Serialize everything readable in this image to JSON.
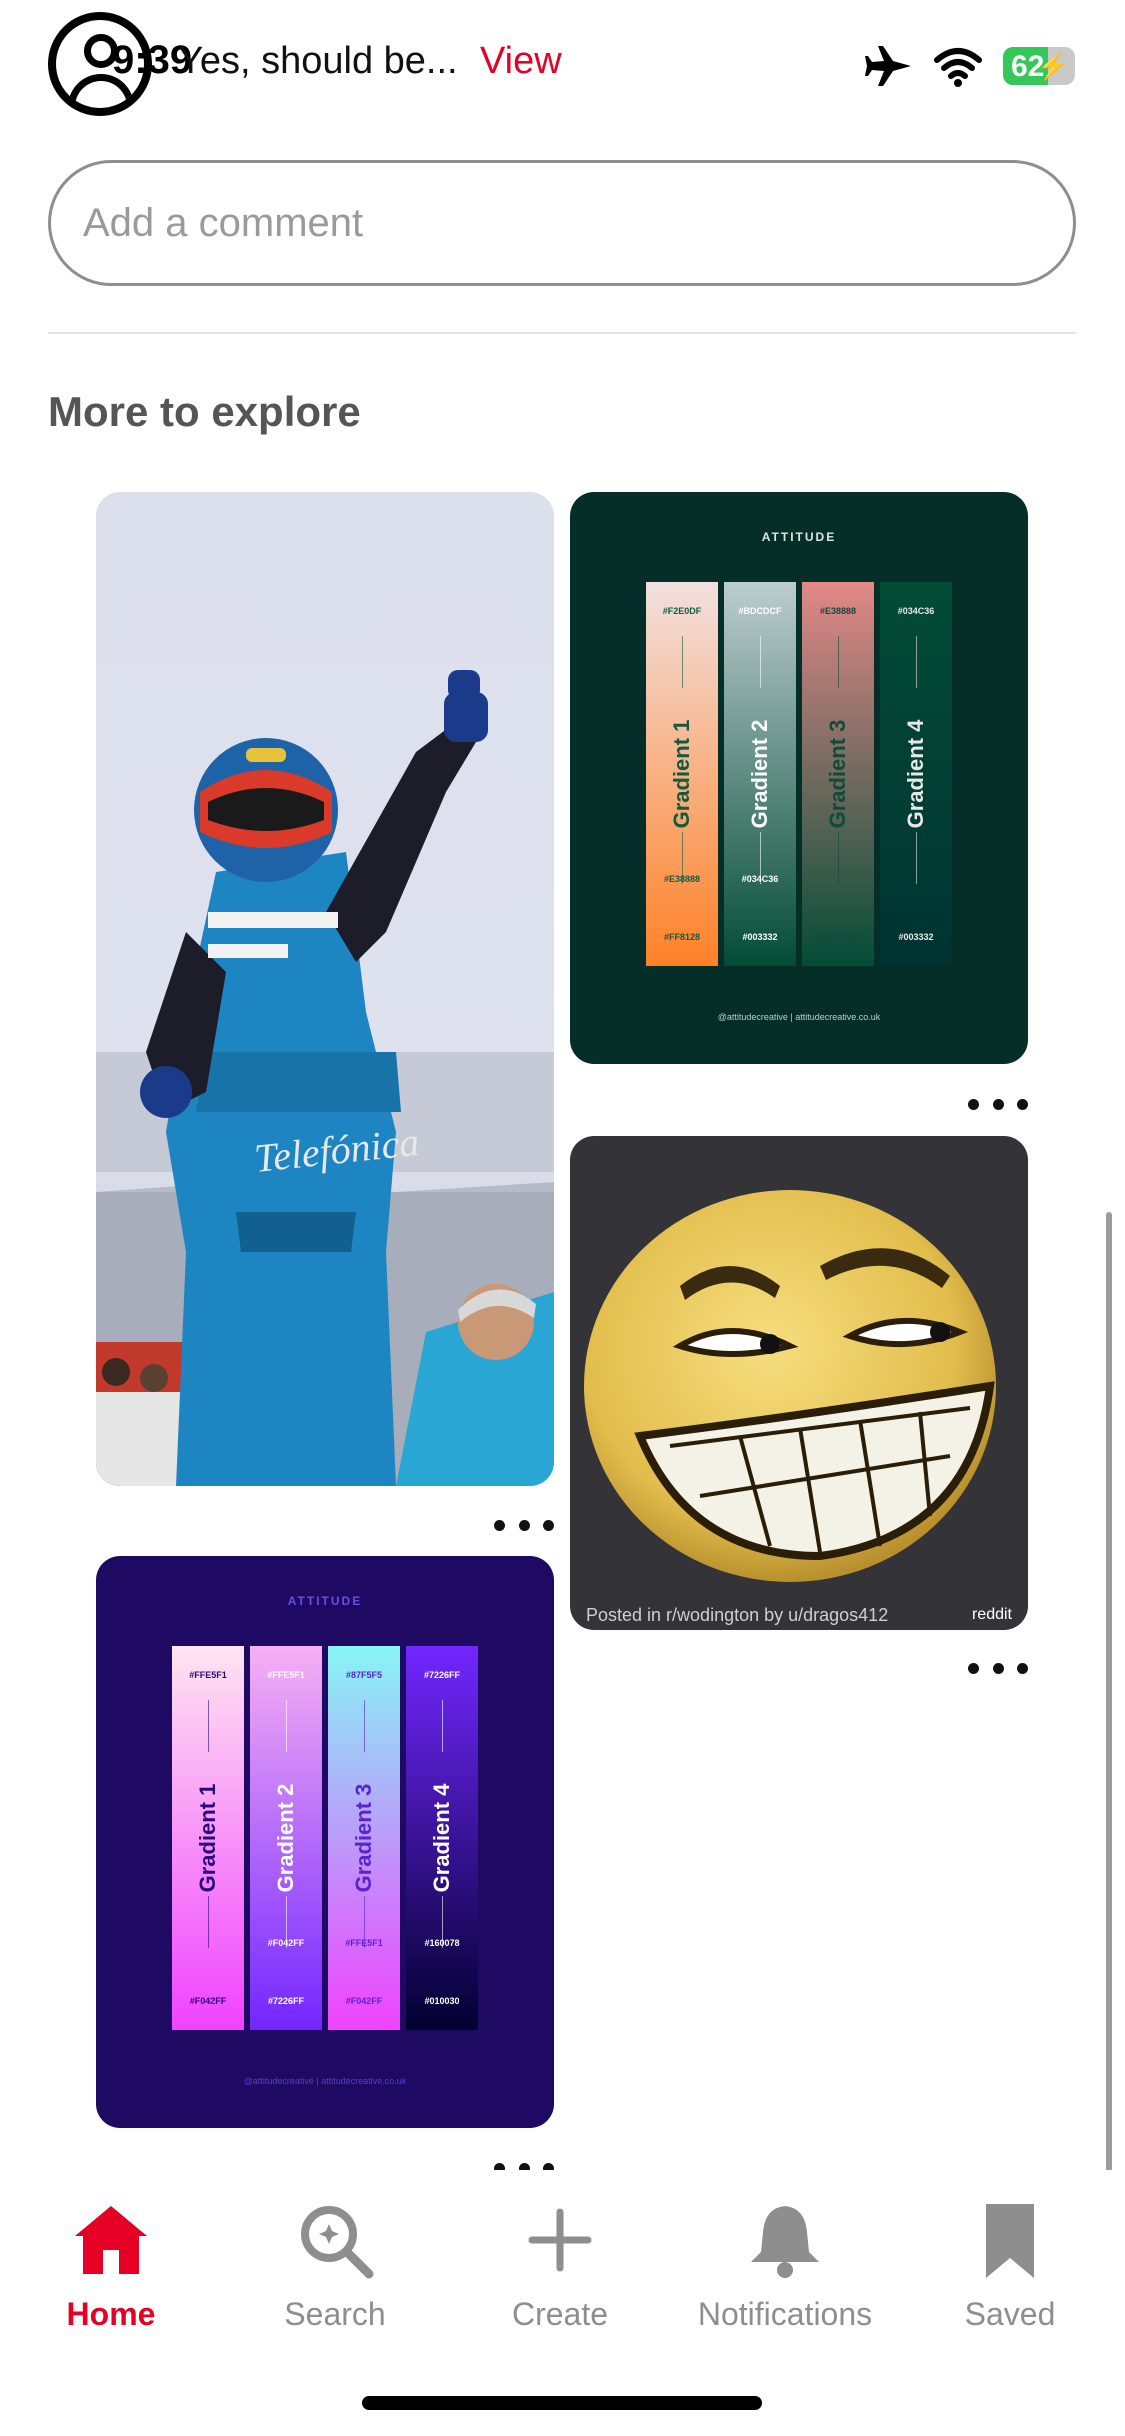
{
  "status_bar": {
    "time": "9:39",
    "battery_percent": "62",
    "comment_preview": "Yes, should be...",
    "view_link": "View"
  },
  "comment_input": {
    "placeholder": "Add a comment"
  },
  "section_title": "More to explore",
  "pins": {
    "palette_green": {
      "brand": "ATTITUDE",
      "footer": "@attitudecreative  |  attitudecreative.co.uk",
      "strips": [
        {
          "name": "Gradient 1",
          "top": "#F2E0DF",
          "mid": "#E38888",
          "bot": "#FF8128",
          "grad_top": "#f2e0df",
          "grad_bot": "#ff8128",
          "ink": "#0f5a40"
        },
        {
          "name": "Gradient 2",
          "top": "#BDCDCF",
          "mid": "#034C36",
          "bot": "#003332",
          "grad_top": "#bdcdcf",
          "grad_bot": "#034c36",
          "ink": "#ffffff"
        },
        {
          "name": "Gradient 3",
          "top": "#E38888",
          "mid": "",
          "bot": "#BDCDCF",
          "grad_top": "#e38888",
          "grad_bot": "#034c36",
          "ink": "#0f4a3a"
        },
        {
          "name": "Gradient 4",
          "top": "#034C36",
          "mid": "",
          "bot": "#003332",
          "grad_top": "#034c36",
          "grad_bot": "#003332",
          "ink": "#e8e8e8"
        }
      ]
    },
    "palette_purple": {
      "brand": "ATTITUDE",
      "footer": "@attitudecreative  |  attitudecreative.co.uk",
      "strips": [
        {
          "name": "Gradient 1",
          "top": "#FFE5F1",
          "mid": "",
          "bot": "#F042FF",
          "grad_top": "#ffe5f1",
          "grad_bot": "#f042ff",
          "ink": "#2a0a7a"
        },
        {
          "name": "Gradient 2",
          "top": "#FFE5F1",
          "mid": "#F042FF",
          "bot": "#7226FF",
          "grad_top": "#f7b0f4",
          "grad_bot": "#7226ff",
          "ink": "#ffffff"
        },
        {
          "name": "Gradient 3",
          "top": "#87F5F5",
          "mid": "#FFE5F1",
          "bot": "#F042FF",
          "grad_top": "#87f5f5",
          "grad_bot": "#f042ff",
          "ink": "#5a22d0"
        },
        {
          "name": "Gradient 4",
          "top": "#7226FF",
          "mid": "#160078",
          "bot": "#010030",
          "grad_top": "#7226ff",
          "grad_bot": "#010030",
          "ink": "#ffffff"
        }
      ]
    },
    "meme": {
      "caption": "Posted in r/wodington by u/dragos412",
      "badge": "reddit"
    }
  },
  "nav": {
    "items": [
      {
        "label": "Home",
        "icon": "home-icon",
        "active": true
      },
      {
        "label": "Search",
        "icon": "search-icon",
        "active": false
      },
      {
        "label": "Create",
        "icon": "plus-icon",
        "active": false
      },
      {
        "label": "Notifications",
        "icon": "bell-icon",
        "active": false
      },
      {
        "label": "Saved",
        "icon": "bookmark-icon",
        "active": false
      }
    ]
  },
  "colors": {
    "accent": "#e60023",
    "inactive": "#8e8e8e",
    "battery_green": "#34c759"
  }
}
